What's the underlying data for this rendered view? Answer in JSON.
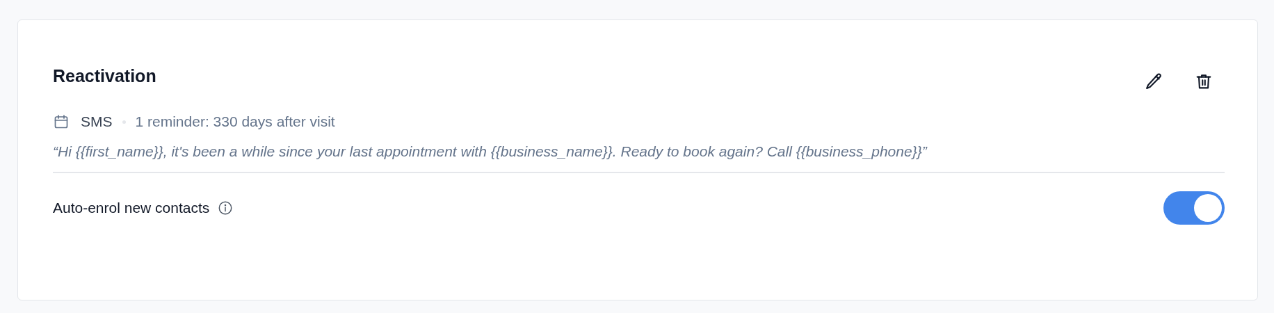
{
  "card": {
    "title": "Reactivation",
    "channel": "SMS",
    "schedule": "1 reminder: 330 days after visit",
    "message": "“Hi {{first_name}}, it's been a while since your last appointment with {{business_name}}. Ready to book again? Call {{business_phone}}”"
  },
  "setting": {
    "label": "Auto-enrol new contacts",
    "on": true
  }
}
